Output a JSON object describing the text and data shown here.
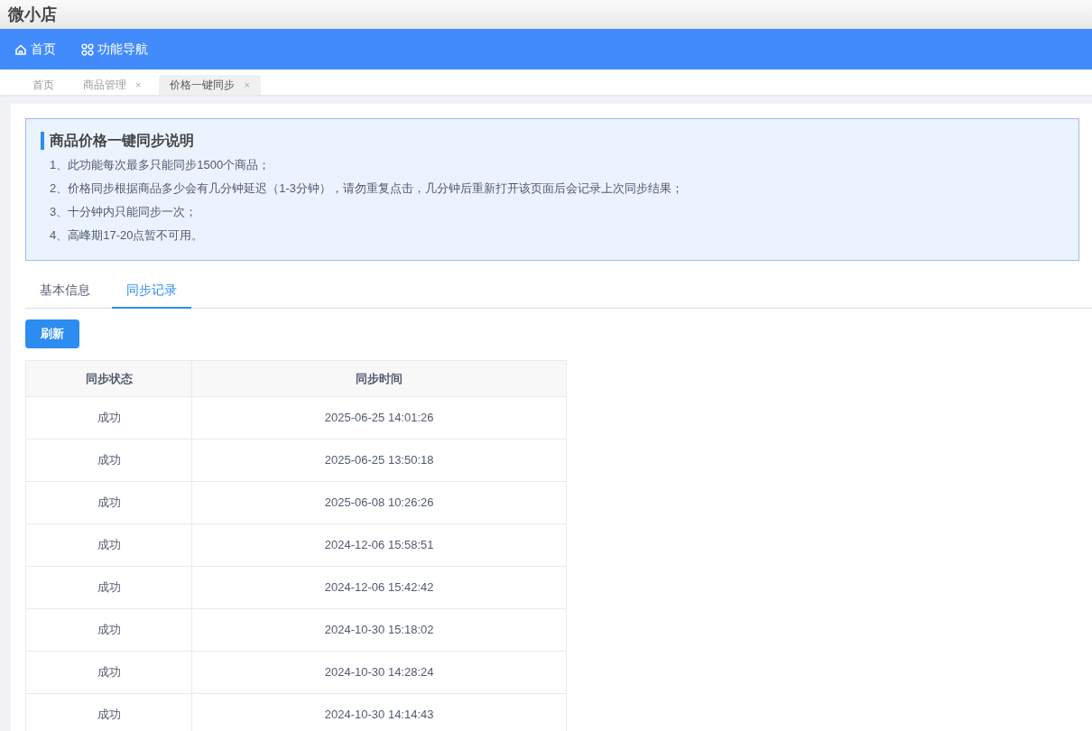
{
  "app": {
    "title": "微小店"
  },
  "nav": [
    {
      "label": "首页",
      "kind": "home"
    },
    {
      "label": "功能导航",
      "kind": "grid"
    }
  ],
  "page_tabs": [
    {
      "label": "首页",
      "selected": false
    },
    {
      "label": "商品管理",
      "selected": false,
      "close": "×"
    },
    {
      "label": "价格一键同步",
      "selected": true,
      "close": "×"
    }
  ],
  "notice": {
    "title": "商品价格一键同步说明",
    "items": [
      "1、此功能每次最多只能同步1500个商品；",
      "2、价格同步根据商品多少会有几分钟延迟（1-3分钟），请勿重复点击，几分钟后重新打开该页面后会记录上次同步结果；",
      "3、十分钟内只能同步一次；",
      "4、高峰期17-20点暂不可用。"
    ]
  },
  "tabs": [
    {
      "label": "基本信息",
      "selected": false
    },
    {
      "label": "同步记录",
      "selected": true
    }
  ],
  "refresh_button": "刷新",
  "table": {
    "columns": [
      "同步状态",
      "同步时间"
    ],
    "rows": [
      [
        "成功",
        "2025-06-25 14:01:26"
      ],
      [
        "成功",
        "2025-06-25 13:50:18"
      ],
      [
        "成功",
        "2025-06-08 10:26:26"
      ],
      [
        "成功",
        "2024-12-06 15:58:51"
      ],
      [
        "成功",
        "2024-12-06 15:42:42"
      ],
      [
        "成功",
        "2024-10-30 15:18:02"
      ],
      [
        "成功",
        "2024-10-30 14:28:24"
      ],
      [
        "成功",
        "2024-10-30 14:14:43"
      ]
    ]
  }
}
